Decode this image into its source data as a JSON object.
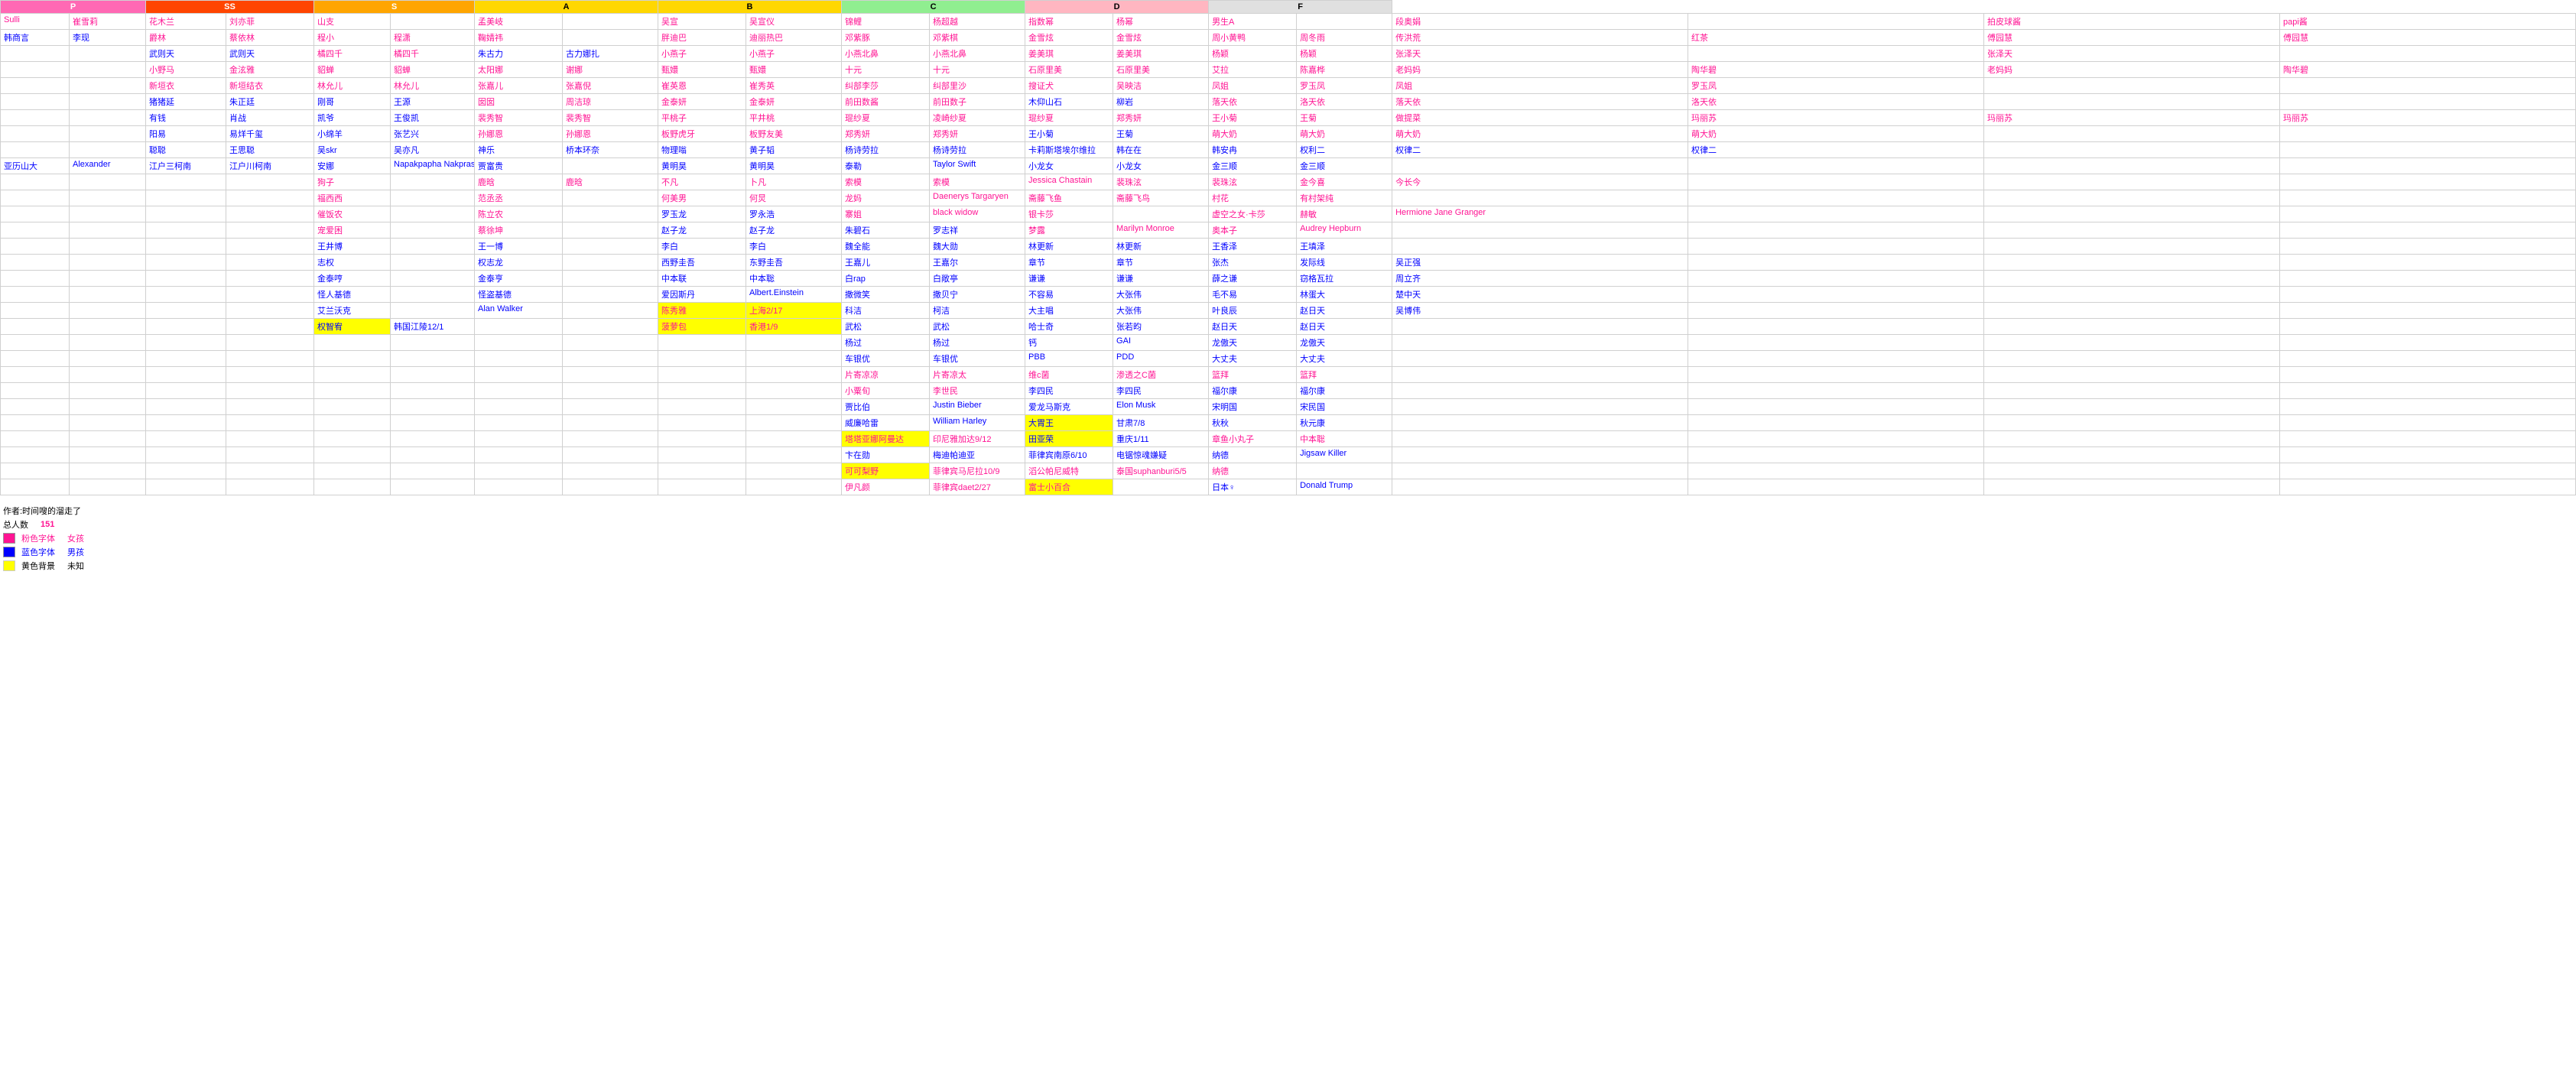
{
  "headers": {
    "p": "P",
    "ss": "SS",
    "s": "S",
    "a": "A",
    "b": "B",
    "c": "C",
    "d": "D",
    "f": "F"
  },
  "rows": [
    {
      "p1": "Sulli",
      "p2": "崔雪莉",
      "ss1": "花木兰",
      "ss2": "刘亦菲",
      "s1": "山支",
      "s2": "",
      "a1": "孟美岐",
      "a2": "",
      "a3": "吴宣",
      "a4": "吴宣仪",
      "b1": "锦鲤",
      "b2": "杨超越",
      "c1": "指数幂",
      "c2": "杨幂",
      "d1": "男生A",
      "d2": "",
      "d3": "段奥娟",
      "d4": "",
      "f1": "拍皮球酱",
      "f2": "papi酱"
    }
  ],
  "p_col": [
    [
      "Sulli",
      "崔雪莉"
    ],
    [
      "韩商言",
      "李现"
    ],
    [
      "",
      "爵林"
    ],
    [
      "",
      "武则天"
    ],
    [
      "",
      "小野马"
    ],
    [
      "",
      "新垣衣"
    ],
    [
      "",
      "猪猪延"
    ],
    [
      "",
      "有钱"
    ],
    [
      "",
      "阳易"
    ],
    [
      "",
      "聪聪"
    ],
    [
      "",
      "亚历山大"
    ]
  ],
  "ss_col": [
    [
      "花木兰",
      "刘亦菲"
    ],
    [
      "",
      "蔡依林"
    ],
    [
      "武则天",
      "武则天"
    ],
    [
      "橘四千",
      "橘四千"
    ],
    [
      "金泫雅",
      "金泫雅"
    ],
    [
      "新垣结衣",
      "新垣结衣"
    ],
    [
      "朱正廷",
      "朱正廷"
    ],
    [
      "肖战",
      "肖战"
    ],
    [
      "易烊千玺",
      "易烊千玺"
    ],
    [
      "王思聪",
      "王思聪"
    ],
    [
      "Alexander",
      "Alexander"
    ]
  ],
  "footer": {
    "author": "作者:时间嗖的溜走了",
    "total_label": "总人数",
    "total_value": "151",
    "pink_label": "粉色字体",
    "pink_meaning": "女孩",
    "blue_label": "蓝色字体",
    "blue_meaning": "男孩",
    "yellow_label": "黄色背景",
    "yellow_meaning": "未知"
  },
  "table_data": {
    "col_headers": [
      "P",
      "SS",
      "S",
      "A",
      "A",
      "B",
      "B",
      "C",
      "C",
      "D",
      "D",
      "F",
      "F"
    ],
    "rows": [
      {
        "p1": "Sulli",
        "p2": "崔雪莉",
        "ss1": "花木兰",
        "ss2": "刘亦菲",
        "s1": "山支",
        "s2": "",
        "a1": "孟美岐",
        "a2": "",
        "a3": "吴宣",
        "a4": "吴宣仪",
        "b1": "锦鲤",
        "b2": "杨超越",
        "c1": "指数幂",
        "c2": "杨幂",
        "d1": "男生A",
        "d2": "",
        "d3": "段奥娟",
        "d4": "",
        "f1": "拍皮球酱",
        "f2": "papi酱"
      }
    ]
  }
}
